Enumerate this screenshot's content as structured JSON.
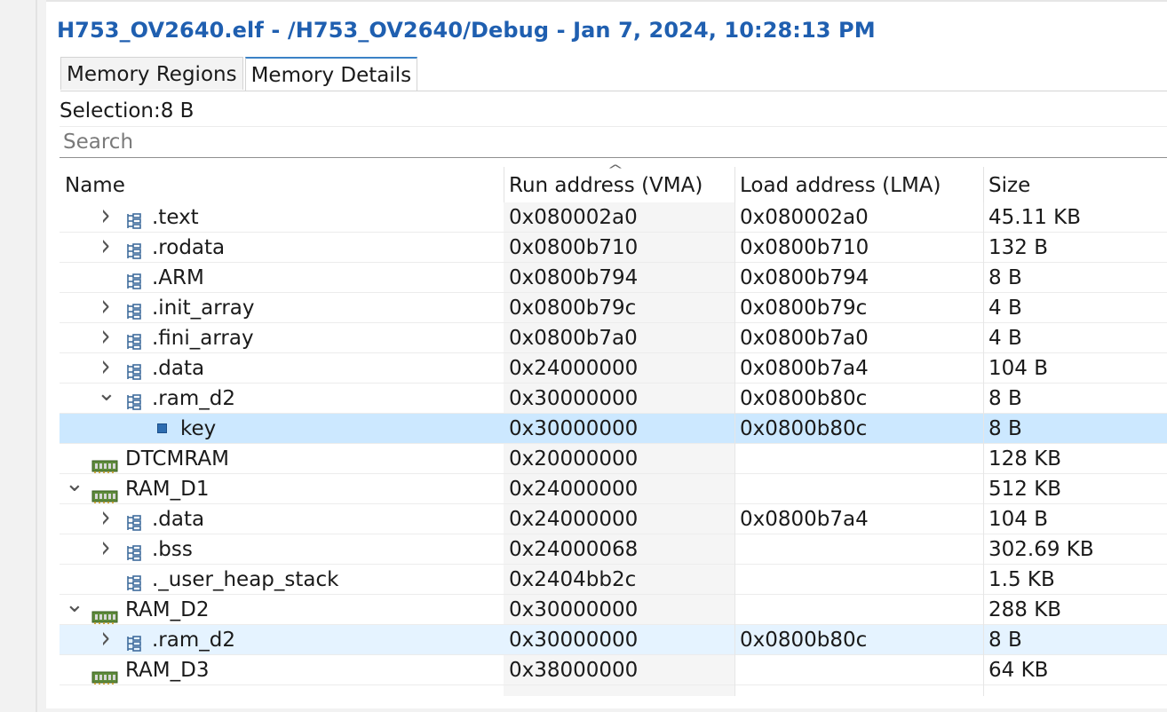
{
  "title": "H753_OV2640.elf - /H753_OV2640/Debug - Jan 7, 2024, 10:28:13 PM",
  "tabs": [
    {
      "label": "Memory Regions",
      "active": false
    },
    {
      "label": "Memory Details",
      "active": true
    }
  ],
  "selection": "Selection:8 B",
  "search": {
    "placeholder": "Search",
    "value": ""
  },
  "columns": {
    "name": "Name",
    "vma": "Run address (VMA)",
    "lma": "Load address (LMA)",
    "size": "Size"
  },
  "sort_indicator": "^",
  "icons": {
    "collapsed": "chevron-right-icon",
    "expanded": "chevron-down-icon",
    "section": "section-tree-icon",
    "region": "memory-chip-icon",
    "symbol": "symbol-square-icon"
  },
  "rows": [
    {
      "name": ".text",
      "vma": "0x080002a0",
      "lma": "0x080002a0",
      "size": "45.11 KB",
      "level": 1,
      "expander": "collapsed",
      "icon": "section"
    },
    {
      "name": ".rodata",
      "vma": "0x0800b710",
      "lma": "0x0800b710",
      "size": "132 B",
      "level": 1,
      "expander": "collapsed",
      "icon": "section"
    },
    {
      "name": ".ARM",
      "vma": "0x0800b794",
      "lma": "0x0800b794",
      "size": "8 B",
      "level": 1,
      "expander": "none",
      "icon": "section"
    },
    {
      "name": ".init_array",
      "vma": "0x0800b79c",
      "lma": "0x0800b79c",
      "size": "4 B",
      "level": 1,
      "expander": "collapsed",
      "icon": "section"
    },
    {
      "name": ".fini_array",
      "vma": "0x0800b7a0",
      "lma": "0x0800b7a0",
      "size": "4 B",
      "level": 1,
      "expander": "collapsed",
      "icon": "section"
    },
    {
      "name": ".data",
      "vma": "0x24000000",
      "lma": "0x0800b7a4",
      "size": "104 B",
      "level": 1,
      "expander": "collapsed",
      "icon": "section"
    },
    {
      "name": ".ram_d2",
      "vma": "0x30000000",
      "lma": "0x0800b80c",
      "size": "8 B",
      "level": 1,
      "expander": "expanded",
      "icon": "section"
    },
    {
      "name": "key",
      "vma": "0x30000000",
      "lma": "0x0800b80c",
      "size": "8 B",
      "level": 2,
      "expander": "none",
      "icon": "symbol",
      "state": "selected"
    },
    {
      "name": "DTCMRAM",
      "vma": "0x20000000",
      "lma": "",
      "size": "128 KB",
      "level": 0,
      "expander": "none",
      "icon": "region"
    },
    {
      "name": "RAM_D1",
      "vma": "0x24000000",
      "lma": "",
      "size": "512 KB",
      "level": 0,
      "expander": "expanded",
      "icon": "region"
    },
    {
      "name": ".data",
      "vma": "0x24000000",
      "lma": "0x0800b7a4",
      "size": "104 B",
      "level": 1,
      "expander": "collapsed",
      "icon": "section"
    },
    {
      "name": ".bss",
      "vma": "0x24000068",
      "lma": "",
      "size": "302.69 KB",
      "level": 1,
      "expander": "collapsed",
      "icon": "section"
    },
    {
      "name": "._user_heap_stack",
      "vma": "0x2404bb2c",
      "lma": "",
      "size": "1.5 KB",
      "level": 1,
      "expander": "none",
      "icon": "section"
    },
    {
      "name": "RAM_D2",
      "vma": "0x30000000",
      "lma": "",
      "size": "288 KB",
      "level": 0,
      "expander": "expanded",
      "icon": "region"
    },
    {
      "name": ".ram_d2",
      "vma": "0x30000000",
      "lma": "0x0800b80c",
      "size": "8 B",
      "level": 1,
      "expander": "collapsed",
      "icon": "section",
      "state": "hover"
    },
    {
      "name": "RAM_D3",
      "vma": "0x38000000",
      "lma": "",
      "size": "64 KB",
      "level": 0,
      "expander": "none",
      "icon": "region"
    }
  ]
}
